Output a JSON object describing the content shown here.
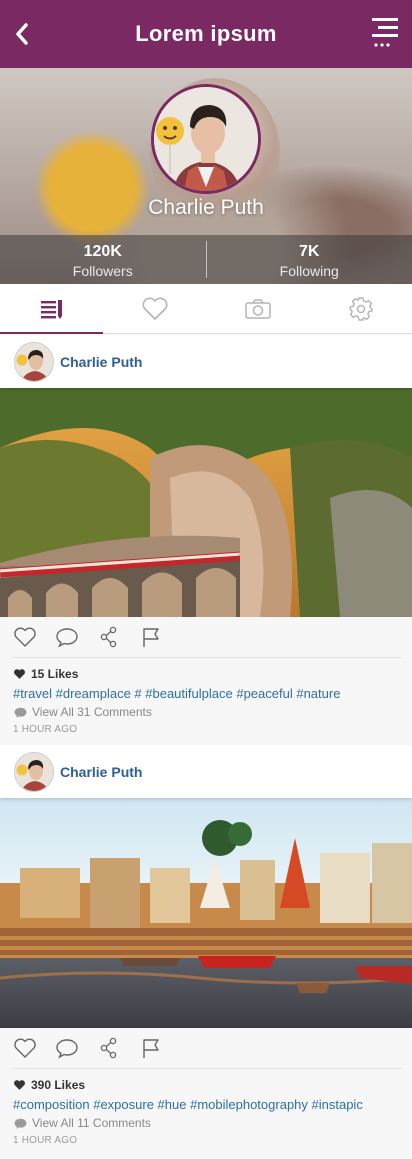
{
  "header": {
    "title": "Lorem ipsum",
    "back_icon": "chevron-left-icon",
    "menu_icon": "menu-icon",
    "background_color": "#7a2962"
  },
  "profile": {
    "name": "Charlie Puth",
    "followers_count": "120K",
    "followers_label": "Followers",
    "following_count": "7K",
    "following_label": "Following"
  },
  "tabs": [
    {
      "icon": "posts-list-icon",
      "active": true
    },
    {
      "icon": "heart-icon",
      "active": false
    },
    {
      "icon": "camera-icon",
      "active": false
    },
    {
      "icon": "gear-icon",
      "active": false
    }
  ],
  "posts": [
    {
      "user": "Charlie Puth",
      "likes": "15 Likes",
      "hashtags": [
        "#travel",
        "#dreamplace",
        "#",
        "#beautifulplace",
        "#peaceful",
        "#nature"
      ],
      "comments": "View All 31 Comments",
      "time": "1 HOUR AGO"
    },
    {
      "user": "Charlie Puth",
      "likes": "390 Likes",
      "hashtags": [
        "#composition",
        "#exposure",
        "#hue",
        "#mobilephotography",
        "#instapic"
      ],
      "comments": "View All 11 Comments",
      "time": "1 HOUR AGO"
    }
  ]
}
